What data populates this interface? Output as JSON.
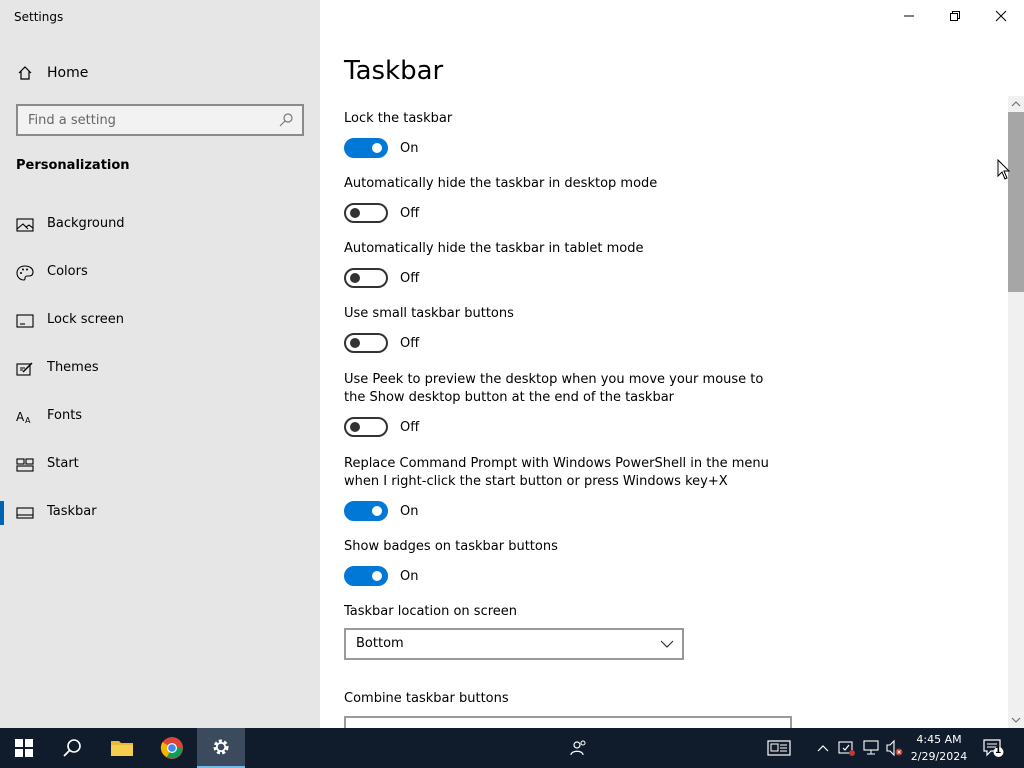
{
  "window": {
    "title": "Settings"
  },
  "sidebar": {
    "home_label": "Home",
    "search_placeholder": "Find a setting",
    "section_title": "Personalization",
    "items": [
      {
        "label": "Background",
        "icon": "image-icon"
      },
      {
        "label": "Colors",
        "icon": "palette-icon"
      },
      {
        "label": "Lock screen",
        "icon": "lock-screen-icon"
      },
      {
        "label": "Themes",
        "icon": "themes-icon"
      },
      {
        "label": "Fonts",
        "icon": "fonts-icon"
      },
      {
        "label": "Start",
        "icon": "start-icon"
      },
      {
        "label": "Taskbar",
        "icon": "taskbar-icon",
        "selected": true
      }
    ]
  },
  "main": {
    "title": "Taskbar",
    "settings": [
      {
        "label": "Lock the taskbar",
        "state": "On"
      },
      {
        "label": "Automatically hide the taskbar in desktop mode",
        "state": "Off"
      },
      {
        "label": "Automatically hide the taskbar in tablet mode",
        "state": "Off"
      },
      {
        "label": "Use small taskbar buttons",
        "state": "Off"
      },
      {
        "label": "Use Peek to preview the desktop when you move your mouse to the Show desktop button at the end of the taskbar",
        "state": "Off"
      },
      {
        "label": "Replace Command Prompt with Windows PowerShell in the menu when I right-click the start button or press Windows key+X",
        "state": "On"
      },
      {
        "label": "Show badges on taskbar buttons",
        "state": "On"
      }
    ],
    "location_label": "Taskbar location on screen",
    "location_value": "Bottom",
    "combine_label": "Combine taskbar buttons"
  },
  "taskbar": {
    "time": "4:45 AM",
    "date": "2/29/2024",
    "notification_count": "1"
  },
  "colors": {
    "accent": "#0078d7",
    "sidebar_bg": "#e6e6e6",
    "taskbar_bg": "#101c2c"
  }
}
